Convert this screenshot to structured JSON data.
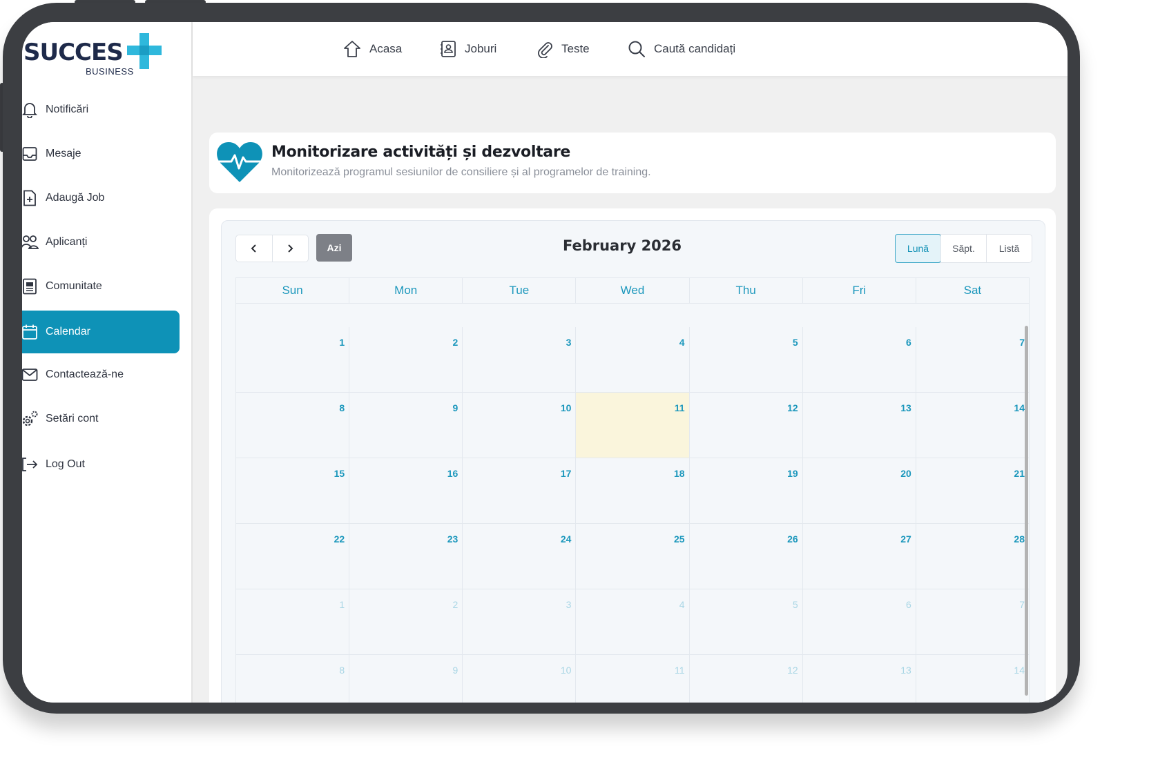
{
  "brand": {
    "name": "SUCCES",
    "sub": "BUSINESS"
  },
  "topnav": [
    {
      "label": "Acasa",
      "icon": "home-icon"
    },
    {
      "label": "Joburi",
      "icon": "contact-book-icon"
    },
    {
      "label": "Teste",
      "icon": "paperclip-icon"
    },
    {
      "label": "Caută candidați",
      "icon": "search-icon"
    }
  ],
  "sidebar": {
    "items": [
      {
        "label": "Notificări",
        "icon": "bell-icon"
      },
      {
        "label": "Mesaje",
        "icon": "inbox-icon"
      },
      {
        "label": "Adaugă Job",
        "icon": "add-document-icon"
      },
      {
        "label": "Aplicanți",
        "icon": "users-icon"
      },
      {
        "label": "Comunitate",
        "icon": "newspaper-icon"
      },
      {
        "label": "Calendar",
        "icon": "calendar-icon",
        "active": true
      },
      {
        "label": "Contactează-ne",
        "icon": "mail-icon"
      },
      {
        "label": "Setări cont",
        "icon": "gears-icon"
      },
      {
        "label": "Log Out",
        "icon": "logout-icon"
      }
    ]
  },
  "header": {
    "title": "Monitorizare activități și dezvoltare",
    "subtitle": "Monitorizează programul sesiunilor de consiliere și al programelor de training.",
    "icon": "heartbeat-icon",
    "accent": "#0e92b7"
  },
  "calendar": {
    "title": "February 2026",
    "today_label": "Azi",
    "views": [
      "Lună",
      "Săpt.",
      "Listă"
    ],
    "active_view": "Lună",
    "weekdays": [
      "Sun",
      "Mon",
      "Tue",
      "Wed",
      "Thu",
      "Fri",
      "Sat"
    ],
    "weeks": [
      [
        "1",
        "2",
        "3",
        "4",
        "5",
        "6",
        "7"
      ],
      [
        "8",
        "9",
        "10",
        "11",
        "12",
        "13",
        "14"
      ],
      [
        "15",
        "16",
        "17",
        "18",
        "19",
        "20",
        "21"
      ],
      [
        "22",
        "23",
        "24",
        "25",
        "26",
        "27",
        "28"
      ],
      [
        "1",
        "2",
        "3",
        "4",
        "5",
        "6",
        "7"
      ],
      [
        "8",
        "9",
        "10",
        "11",
        "12",
        "13",
        "14"
      ]
    ],
    "today": "11",
    "other_month_weeks": [
      4,
      5
    ]
  }
}
